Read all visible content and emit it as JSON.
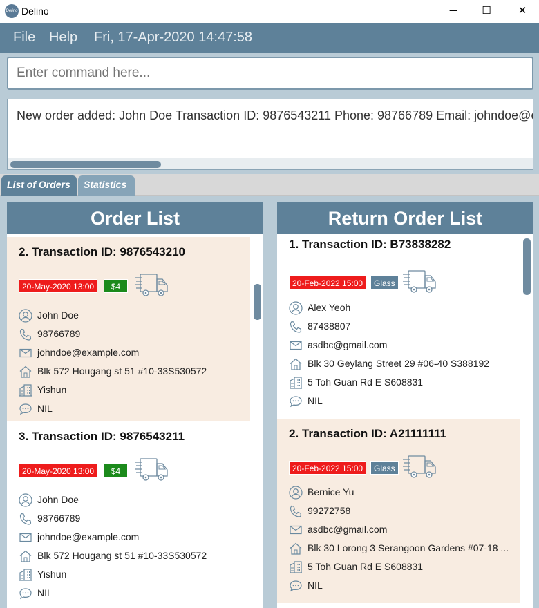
{
  "window": {
    "app_icon_text": "Delino",
    "title": "Delino",
    "minimize": "─",
    "maximize": "☐",
    "close": "✕"
  },
  "menu": {
    "file": "File",
    "help": "Help",
    "datetime": "Fri, 17-Apr-2020 14:47:58"
  },
  "command": {
    "placeholder": "Enter command here..."
  },
  "result": {
    "text": "New order added: John Doe Transaction ID: 9876543211 Phone: 98766789 Email: johndoe@example.com"
  },
  "tabs": {
    "orders": "List of Orders",
    "statistics": "Statistics"
  },
  "order_list": {
    "title": "Order List",
    "items": [
      {
        "title": "2.  Transaction ID: 9876543210",
        "date": "20-May-2020 13:00",
        "price": "$4",
        "name": "John Doe",
        "phone": "98766789",
        "email": "johndoe@example.com",
        "address": "Blk 572 Hougang st 51 #10-33S530572",
        "warehouse": "Yishun",
        "comment": "NIL"
      },
      {
        "title": "3.  Transaction ID: 9876543211",
        "date": "20-May-2020 13:00",
        "price": "$4",
        "name": "John Doe",
        "phone": "98766789",
        "email": "johndoe@example.com",
        "address": "Blk 572 Hougang st 51 #10-33S530572",
        "warehouse": "Yishun",
        "comment": "NIL"
      }
    ]
  },
  "return_list": {
    "title": "Return Order List",
    "items": [
      {
        "title": "1.  Transaction ID: B73838282",
        "date": "20-Feb-2022 15:00",
        "type": "Glass",
        "name": "Alex Yeoh",
        "phone": "87438807",
        "email": "asdbc@gmail.com",
        "address": "Blk 30 Geylang Street 29 #06-40 S388192",
        "warehouse": "5 Toh Guan Rd E S608831",
        "comment": "NIL"
      },
      {
        "title": "2.  Transaction ID: A21111111",
        "date": "20-Feb-2022 15:00",
        "type": "Glass",
        "name": "Bernice Yu",
        "phone": "99272758",
        "email": "asdbc@gmail.com",
        "address": "Blk 30 Lorong 3 Serangoon Gardens #07-18 ...",
        "warehouse": "5 Toh Guan Rd E S608831",
        "comment": "NIL"
      }
    ]
  }
}
